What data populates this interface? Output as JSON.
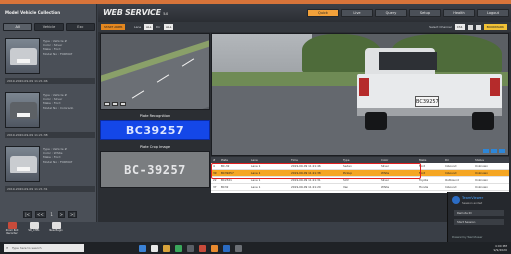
{
  "left_panel": {
    "title": "Model Vehicle Collection",
    "tabs": [
      "All",
      "Vehicle",
      "Exc"
    ],
    "items": [
      {
        "info": [
          "Type : Vehicle #",
          "Color : Silver",
          "Make : Ford",
          "Model No : FORMAT"
        ],
        "time": "2019-2020-09-09 11:21:46"
      },
      {
        "info": [
          "Type : Vehicle #",
          "Color : Silver",
          "Make : Ford",
          "Model No : Colorado"
        ],
        "time": "2019-2020-09-09 11:21:38"
      },
      {
        "info": [
          "Type : Vehicle #",
          "Color : White",
          "Make : Ford",
          "Model No : FORMAT"
        ],
        "time": "2019-2020-09-09 11:21:31"
      }
    ],
    "pager": {
      "first": "|<",
      "prev": "<<",
      "current": "1",
      "next": ">",
      "last": ">|"
    }
  },
  "header": {
    "brand": "WEB SERVICE",
    "version": "5.0",
    "nav": [
      "Quick",
      "Live",
      "Query",
      "Setup",
      "Health",
      "Logout"
    ],
    "active_nav": "Quick"
  },
  "subbar": {
    "start_button": "START ANPR",
    "labels": [
      "Lane",
      "Dir"
    ],
    "boxes": [
      "ALL",
      "ALL"
    ],
    "right_label": "Select Channel",
    "right_value": "Ch1",
    "bookmark": "BOOKMARK"
  },
  "plate_sections": [
    {
      "label": "Plate Recognition",
      "value": "BC39257"
    },
    {
      "label": "Plate Crop Image",
      "value": "BC-39257"
    }
  ],
  "truck_plate": "BC39257",
  "results": {
    "headers": [
      "#",
      "Plate",
      "Lane",
      "Time",
      "Type",
      "Color",
      "Make",
      "Dir",
      "Status"
    ],
    "rows": [
      [
        "4",
        "BC-32",
        "Lane 1",
        "2019-09-09 11:21:46",
        "Sedan",
        "Silver",
        "Ford",
        "Inbound",
        "Unknown"
      ],
      [
        "39",
        "BC39257",
        "Lane 1",
        "2019-09-09 11:21:38",
        "Pickup",
        "White",
        "Ford",
        "Inbound",
        "Unknown"
      ],
      [
        "22",
        "BC2321",
        "Lane 1",
        "2019-09-09 11:21:31",
        "SUV",
        "Silver",
        "Toyota",
        "Outbound",
        "Unknown"
      ],
      [
        "37",
        "BC32",
        "Lane 1",
        "2019-09-09 11:21:20",
        "Van",
        "White",
        "Honda",
        "Inbound",
        "Unknown"
      ]
    ],
    "highlighted_row": 1
  },
  "desktop_icons": [
    {
      "label": "Zoom Roll Recorder",
      "color": "#c84b3b"
    },
    {
      "label": "SR_CHEL",
      "color": "#e0e0e0"
    },
    {
      "label": "New Begin",
      "color": "#e0e0e0"
    }
  ],
  "taskbar": {
    "search_placeholder": "Type here to search",
    "clock_time": "4:00 PM",
    "clock_date": "9/9/2020"
  },
  "notification": {
    "title": "TeamViewer",
    "subtitle": "Session ended",
    "buttons": [
      "Remote ID",
      "Start Session"
    ],
    "footer": "Powered by TeamViewer"
  },
  "colors": {
    "accent": "#f2a13b",
    "plate_blue": "#1447e8",
    "highlight_row": "#f5a623",
    "annotation_red": "#e02020"
  }
}
